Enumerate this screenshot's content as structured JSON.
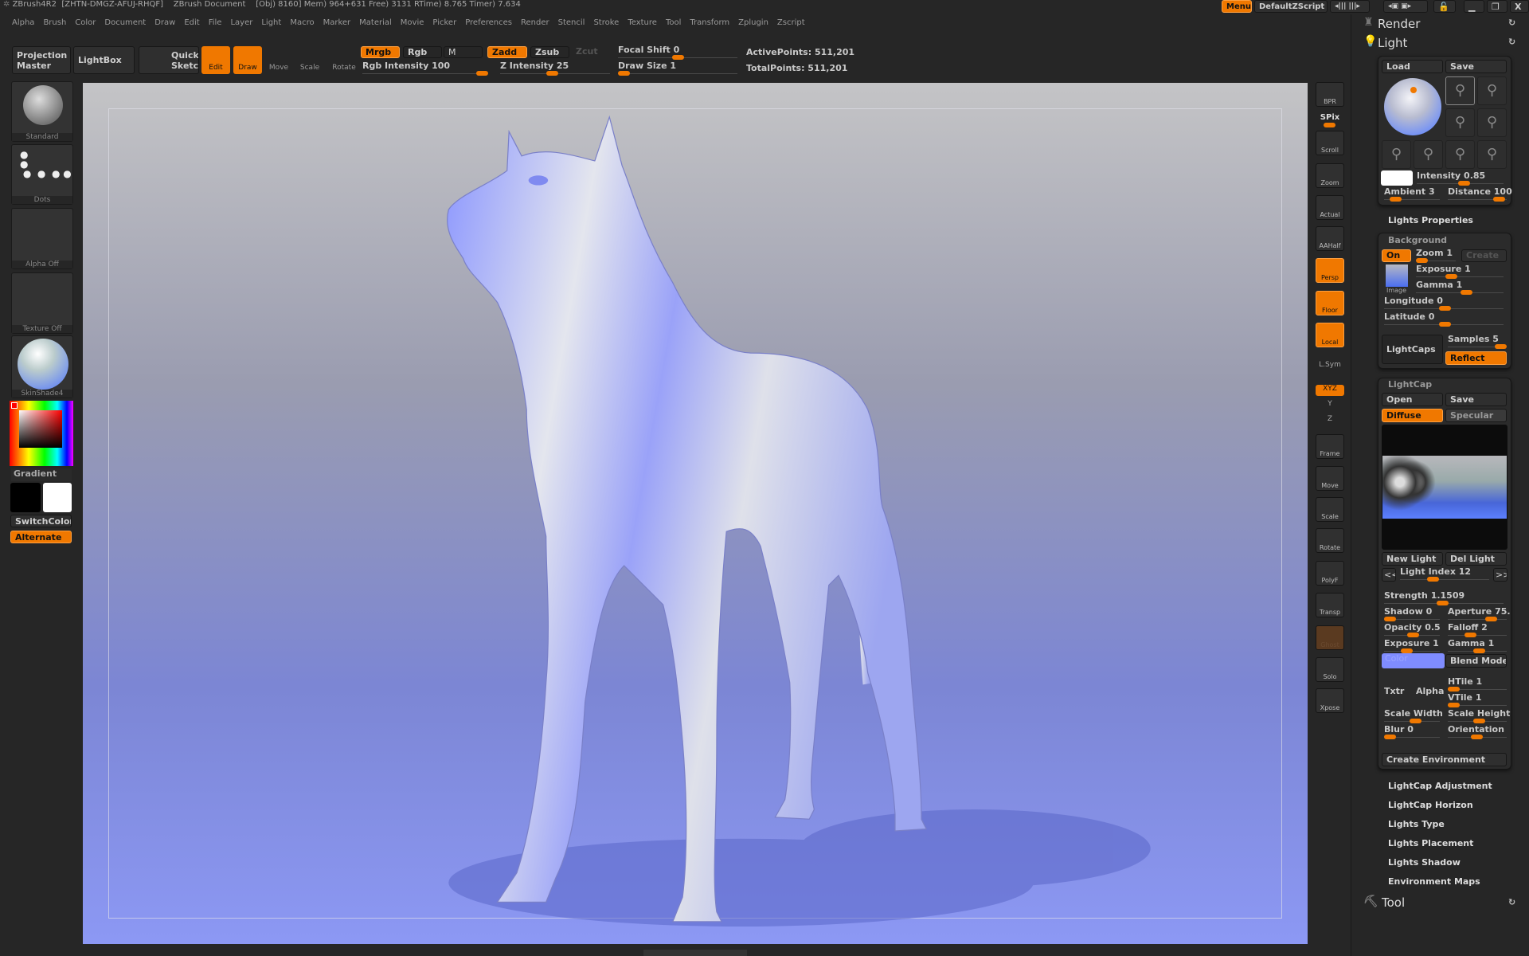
{
  "title_bar": {
    "app": "ZBrush4R2",
    "serial": "[ZHTN-DMGZ-AFUJ-RHQF]",
    "document": "ZBrush Document",
    "stats": "[Obj) 8160]  Mem) 964+631  Free) 3131  RTime) 8.765  Timer) 7.634"
  },
  "menus": [
    "Alpha",
    "Brush",
    "Color",
    "Document",
    "Draw",
    "Edit",
    "File",
    "Layer",
    "Light",
    "Macro",
    "Marker",
    "Material",
    "Movie",
    "Picker",
    "Preferences",
    "Render",
    "Stencil",
    "Stroke",
    "Texture",
    "Tool",
    "Transform",
    "Zplugin",
    "Zscript"
  ],
  "top_right": {
    "menus": "Menus",
    "script": "DefaultZScript"
  },
  "toolbar": {
    "projection_master": "Projection Master",
    "lightbox": "LightBox",
    "quick_sketch": "Quick Sketch",
    "edit": "Edit",
    "draw": "Draw",
    "move": "Move",
    "scale": "Scale",
    "rotate": "Rotate",
    "mrgb": "Mrgb",
    "rgb": "Rgb",
    "m": "M",
    "zadd": "Zadd",
    "zsub": "Zsub",
    "zcut": "Zcut",
    "rgb_intensity": "Rgb Intensity 100",
    "z_intensity": "Z Intensity 25",
    "focal_shift": "Focal Shift 0",
    "draw_size": "Draw Size 1",
    "active_points": "ActivePoints: 511,201",
    "total_points": "TotalPoints: 511,201"
  },
  "left_shelf": {
    "brush": "Standard",
    "stroke": "Dots",
    "alpha": "Alpha Off",
    "texture": "Texture Off",
    "material": "SkinShade4",
    "gradient": "Gradient",
    "switch_color": "SwitchColor",
    "alternate": "Alternate"
  },
  "right_shelf": [
    "BPR",
    "SPix",
    "Scroll",
    "Zoom",
    "Actual",
    "AAHalf",
    "Persp",
    "Floor",
    "Local",
    "L.Sym",
    "XYZ",
    "Y",
    "Z",
    "Frame",
    "Move",
    "Scale",
    "Rotate",
    "PolyF",
    "Transp",
    "Ghost",
    "Solo",
    "Xpose"
  ],
  "panel": {
    "render": "Render",
    "light": "Light",
    "load": "Load",
    "save": "Save",
    "intensity": "Intensity 0.85",
    "ambient": "Ambient 3",
    "distance": "Distance 100",
    "lights_properties": "Lights Properties",
    "background": {
      "title": "Background",
      "on": "On",
      "zoom": "Zoom 1",
      "create": "Create",
      "image": "Image",
      "exposure": "Exposure 1",
      "gamma": "Gamma 1",
      "longitude": "Longitude 0",
      "latitude": "Latitude 0",
      "lightcaps": "LightCaps",
      "samples": "Samples 5",
      "reflect": "Reflect"
    },
    "lightcap": {
      "title": "LightCap",
      "open": "Open",
      "save": "Save",
      "diffuse": "Diffuse",
      "specular": "Specular",
      "new_light": "New Light",
      "del_light": "Del Light",
      "prev": "<<",
      "next": ">>",
      "light_index": "Light Index 12",
      "strength": "Strength 1.1509",
      "shadow": "Shadow 0",
      "aperture": "Aperture 75.",
      "opacity": "Opacity 0.5",
      "falloff": "Falloff 2",
      "exposure": "Exposure 1",
      "gamma": "Gamma 1",
      "color": "Color",
      "color_value": "#7f8cff",
      "blend_mode": "Blend Mode",
      "txtr": "Txtr",
      "alpha": "Alpha",
      "htile": "HTile 1",
      "vtile": "VTile 1",
      "scale_width": "Scale Width",
      "scale_height": "Scale Height",
      "blur": "Blur 0",
      "orientation": "Orientation",
      "create_environment": "Create Environment"
    },
    "subpanels": [
      "LightCap Adjustment",
      "LightCap Horizon",
      "Lights Type",
      "Lights Placement",
      "Lights Shadow",
      "Environment Maps"
    ],
    "tool": "Tool"
  },
  "colors": {
    "accent": "#f07800",
    "background": "#262626"
  }
}
